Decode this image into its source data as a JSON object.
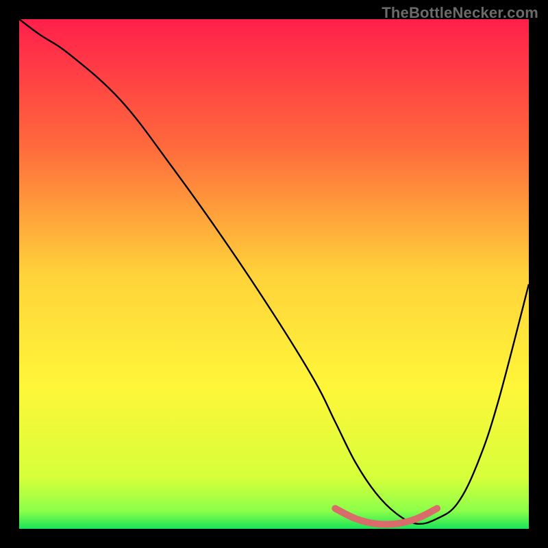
{
  "watermark": "TheBottleNecker.com",
  "chart_data": {
    "type": "line",
    "title": "",
    "xlabel": "",
    "ylabel": "",
    "xlim": [
      0,
      100
    ],
    "ylim": [
      0,
      100
    ],
    "grid": false,
    "gradient_stops": [
      {
        "offset": 0.0,
        "color": "#ff1f4b"
      },
      {
        "offset": 0.25,
        "color": "#ff6a3c"
      },
      {
        "offset": 0.5,
        "color": "#ffd23a"
      },
      {
        "offset": 0.72,
        "color": "#fff639"
      },
      {
        "offset": 0.9,
        "color": "#d6ff3a"
      },
      {
        "offset": 0.965,
        "color": "#8cff4a"
      },
      {
        "offset": 1.0,
        "color": "#19e35a"
      }
    ],
    "series": [
      {
        "name": "bottleneck-curve",
        "color": "#000000",
        "x": [
          0,
          4,
          10,
          20,
          30,
          40,
          50,
          58,
          62,
          66,
          70,
          74,
          78,
          82,
          86,
          90,
          94,
          100
        ],
        "y": [
          100,
          97,
          93,
          84,
          71,
          57,
          42,
          29,
          21,
          13,
          7,
          3,
          1,
          2,
          5,
          13,
          25,
          48
        ]
      }
    ],
    "marker": {
      "name": "optimal-range",
      "color": "#d96b6b",
      "x": [
        62,
        66,
        70,
        74,
        78,
        82
      ],
      "y": [
        4,
        2,
        1,
        1,
        2,
        4
      ]
    }
  }
}
